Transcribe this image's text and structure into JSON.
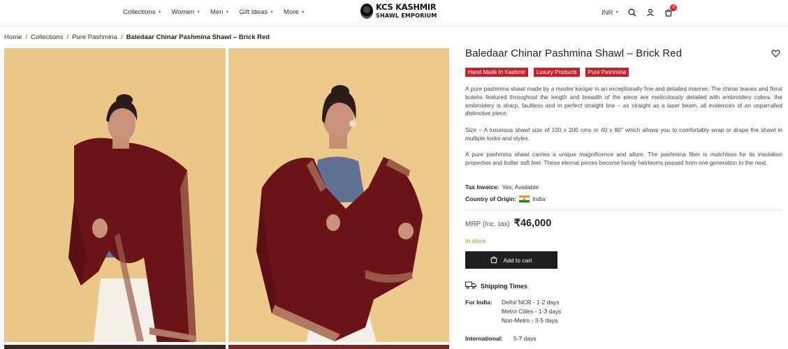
{
  "header": {
    "nav": [
      "Collections",
      "Women",
      "Men",
      "Gift Ideas",
      "More"
    ],
    "logo": {
      "line1": "KCS KASHMIR",
      "line2": "SHAWL EMPORIUM"
    },
    "currency": "INR",
    "cart_count": "0"
  },
  "breadcrumb": [
    "Home",
    "Collections",
    "Pure Pashmina",
    "Baledaar Chinar Pashmina Shawl – Brick Red"
  ],
  "product": {
    "title": "Baledaar Chinar Pashmina Shawl – Brick Red",
    "tags": [
      "Hand Made In Kashmir",
      "Luxury Products",
      "Pure Pashmina"
    ],
    "description": [
      "A pure pashmina shawl made by a master karigar in an exceptionally fine and detailed manner. The chinar leaves and floral butehs featured throughout the length and breadth of the piece are meticulously detailed with embroidery colors, the embroidery is sharp, faultless and in perfect straight line – as straight as a laser beam, all evidences of an unparralled distinctive piece.",
      "Size – A luxurious shawl size of 100 x 200 cms or 40 x 80\" which allows you to comfortably wrap or drape the shawl in multiple looks and styles.",
      "A pure pashmina shawl carries a unique magnificence and allure. The pashmina fiber is matchless for its insulation properties and butter soft feel. These eternal pieces become family heirlooms passed from one generation to the next."
    ],
    "tax_invoice_label": "Tax Invoice:",
    "tax_invoice_value": "Yes, Available",
    "origin_label": "Country of Origin:",
    "origin_value": "India",
    "mrp_label": "MRP (Inc. tax)",
    "price": "₹46,000",
    "stock": "In stock",
    "add_to_cart": "Add to cart"
  },
  "shipping": {
    "title": "Shipping Times",
    "india_label": "For India:",
    "india_lines": [
      "Delhi/ NCR - 1-2 days",
      "Metro Cities - 1-3 days",
      "Non-Metro - 3-5 days"
    ],
    "intl_label": "International:",
    "intl_value": "5-7 days"
  },
  "colors": {
    "tag_red": "#c8202a",
    "button_dark": "#1f1f1f",
    "stock_green": "#8a9a2a",
    "shawl_maroon": "#6b1418",
    "backdrop": "#ecc98c"
  }
}
